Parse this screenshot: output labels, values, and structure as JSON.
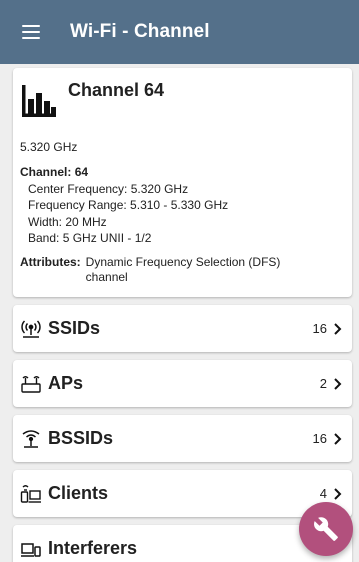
{
  "appbar": {
    "title": "Wi-Fi - Channel",
    "menu_icon": "menu-icon"
  },
  "detail": {
    "icon": "channel-bars-icon",
    "title": "Channel 64",
    "frequency": "5.320 GHz",
    "channel_label": "Channel:",
    "channel_value": "64",
    "center_frequency": "Center Frequency:  5.320 GHz",
    "frequency_range": "Frequency Range:  5.310 - 5.330 GHz",
    "width": "Width:  20 MHz",
    "band": "Band:  5 GHz UNII - 1/2",
    "attributes_label": "Attributes:",
    "attributes_value": "Dynamic Frequency Selection (DFS) channel"
  },
  "rows": [
    {
      "label": "SSIDs",
      "count": "16",
      "icon": "ssid-broadcast-icon"
    },
    {
      "label": "APs",
      "count": "2",
      "icon": "access-point-icon"
    },
    {
      "label": "BSSIDs",
      "count": "16",
      "icon": "bssid-antenna-icon"
    },
    {
      "label": "Clients",
      "count": "4",
      "icon": "clients-devices-icon"
    },
    {
      "label": "Interferers",
      "count": "",
      "icon": "interferers-devices-icon"
    }
  ],
  "fab": {
    "icon": "wrench-icon"
  },
  "colors": {
    "appbar": "#54708a",
    "fab": "#b2507d",
    "background": "#eeeeee"
  }
}
